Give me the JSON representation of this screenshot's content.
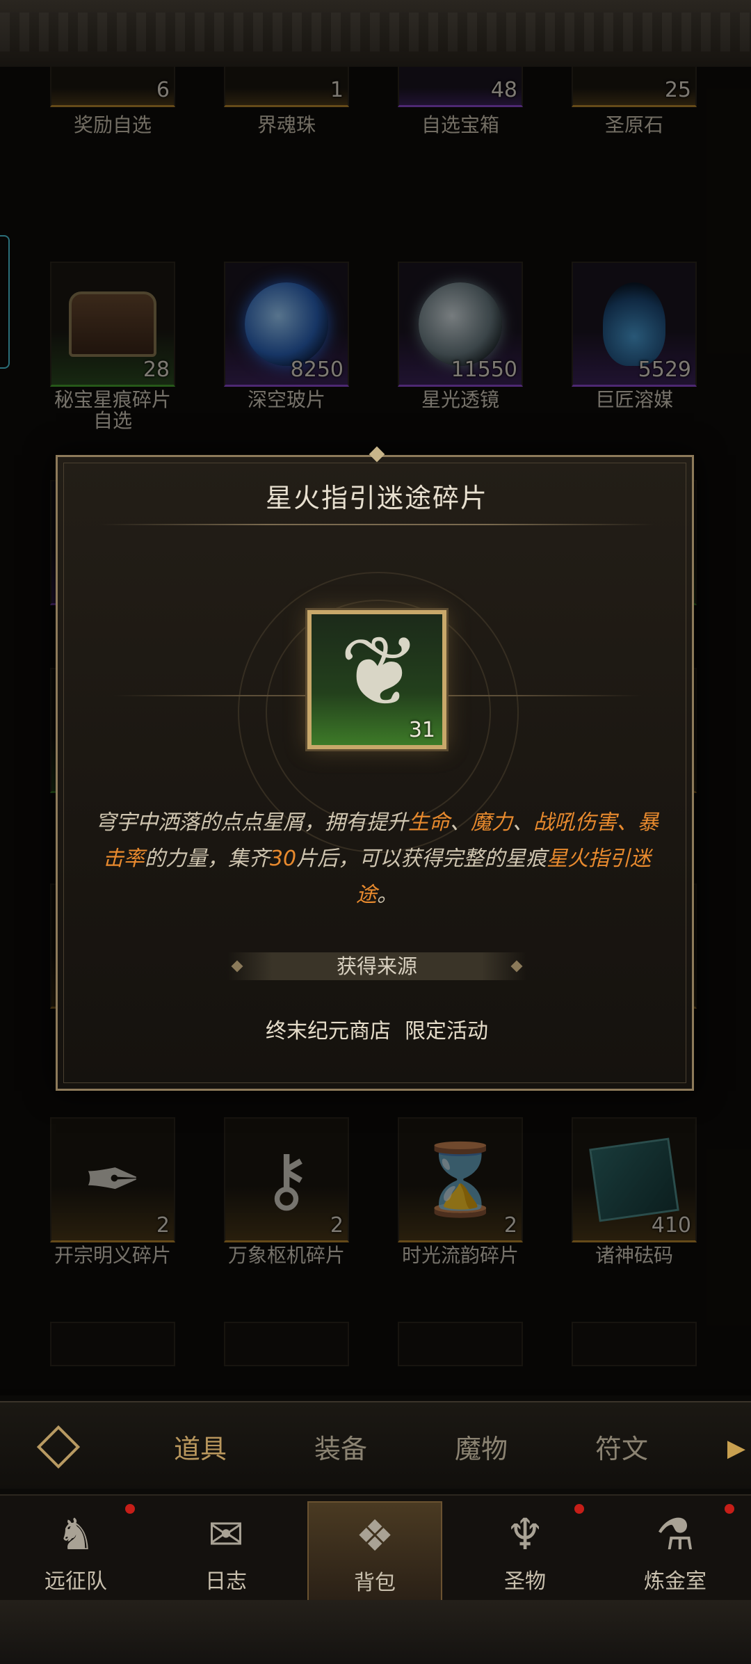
{
  "inventory": {
    "row0": [
      {
        "name": "奖励自选",
        "count": "6",
        "rarity": "gold"
      },
      {
        "name": "界魂珠",
        "count": "1",
        "rarity": "gold"
      },
      {
        "name": "自选宝箱",
        "count": "48",
        "rarity": "purple"
      },
      {
        "name": "圣原石",
        "count": "25",
        "rarity": "gold"
      }
    ],
    "row1": [
      {
        "name": "秘宝星痕碎片自选",
        "count": "28",
        "rarity": "green",
        "icon": "treasure-chest-icon"
      },
      {
        "name": "深空玻片",
        "count": "8250",
        "rarity": "purple",
        "icon": "blue-orb-icon"
      },
      {
        "name": "星光透镜",
        "count": "11550",
        "rarity": "purple",
        "icon": "grey-lens-icon"
      },
      {
        "name": "巨匠溶媒",
        "count": "5529",
        "rarity": "purple",
        "icon": "potion-flask-icon"
      }
    ],
    "row5": [
      {
        "name": "开宗明义碎片",
        "count": "2",
        "rarity": "gold",
        "icon": "quill-book-icon"
      },
      {
        "name": "万象枢机碎片",
        "count": "2",
        "rarity": "gold",
        "icon": "key-icon"
      },
      {
        "name": "时光流韵碎片",
        "count": "2",
        "rarity": "gold",
        "icon": "hourglass-icon"
      },
      {
        "name": "诸神砝码",
        "count": "410",
        "rarity": "gold",
        "icon": "rune-stone-icon"
      }
    ]
  },
  "tabs": {
    "items": [
      "道具",
      "装备",
      "魔物",
      "符文"
    ],
    "active": "道具"
  },
  "nav": [
    {
      "label": "远征队",
      "badge": true,
      "icon": "horned-helmet-icon"
    },
    {
      "label": "日志",
      "badge": false,
      "icon": "scroll-icon"
    },
    {
      "label": "背包",
      "badge": false,
      "active": true,
      "icon": "backpack-icon"
    },
    {
      "label": "圣物",
      "badge": true,
      "icon": "chalice-icon"
    },
    {
      "label": "炼金室",
      "badge": true,
      "icon": "alchemy-icon"
    }
  ],
  "modal": {
    "title": "星火指引迷途碎片",
    "item_count": "31",
    "desc": {
      "p1": "穹宇中洒落的点点星屑，拥有提升",
      "h1": "生命",
      "s1": "、",
      "h2": "魔力",
      "s2": "、",
      "h3": "战吼伤害",
      "s3": "、",
      "h4": "暴击率",
      "p2": "的力量，集齐",
      "h5": "30",
      "p3": "片后，可以获得完整的星痕",
      "h6": "星火指引迷途",
      "p4": "。"
    },
    "source_header": "获得来源",
    "sources": [
      "终末纪元商店",
      "限定活动"
    ]
  },
  "colors": {
    "highlight": "#e88a2e",
    "frame_gold": "#c8a86a",
    "rarity_green": "#46a02f",
    "rarity_purple": "#8c49d0",
    "badge_red": "#c61e18"
  }
}
